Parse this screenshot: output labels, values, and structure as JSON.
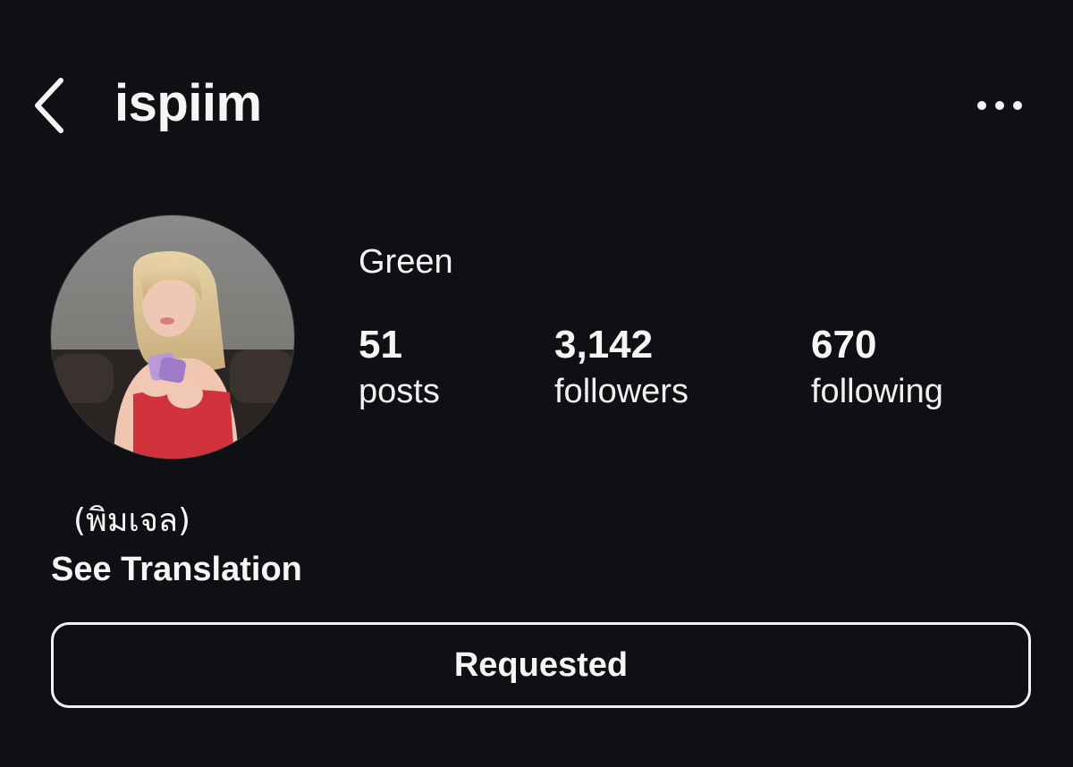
{
  "header": {
    "username": "ispiim",
    "back_icon": "chevron-left-icon",
    "more_icon": "more-horizontal-icon"
  },
  "profile": {
    "display_name": "Green",
    "bio": "(พิมเจล)",
    "see_translation": "See Translation",
    "avatar_icon": "profile-photo"
  },
  "stats": [
    {
      "value": "51",
      "label": "posts"
    },
    {
      "value": "3,142",
      "label": "followers"
    },
    {
      "value": "670",
      "label": "following"
    }
  ],
  "actions": {
    "follow_state_label": "Requested"
  },
  "colors": {
    "background": "#0f1014",
    "text": "#f5f5f5",
    "button_border": "#f2f2f2"
  }
}
